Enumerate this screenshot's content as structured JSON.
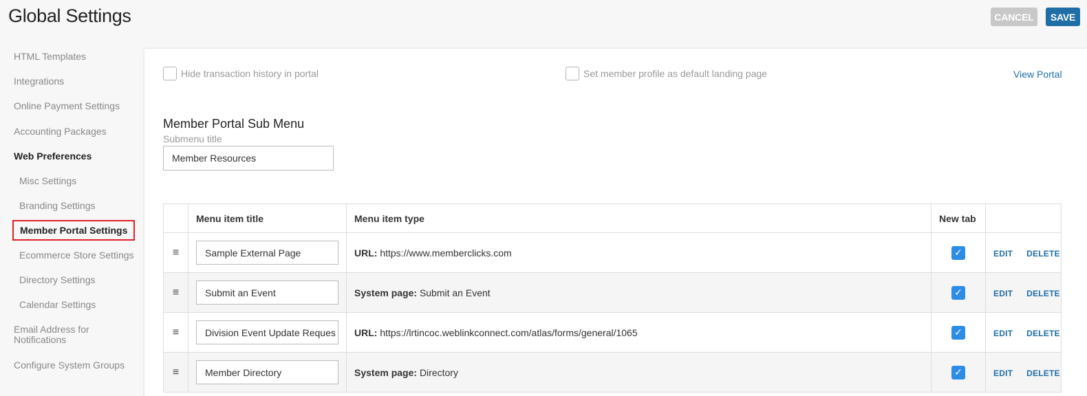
{
  "page_title": "Global Settings",
  "buttons": {
    "cancel": "CANCEL",
    "save": "SAVE"
  },
  "sidebar": {
    "items": [
      {
        "label": "HTML Templates"
      },
      {
        "label": "Integrations"
      },
      {
        "label": "Online Payment Settings"
      },
      {
        "label": "Accounting Packages"
      },
      {
        "label": "Web Preferences"
      },
      {
        "label": "Misc Settings"
      },
      {
        "label": "Branding Settings"
      },
      {
        "label": "Member Portal Settings"
      },
      {
        "label": "Ecommerce Store Settings"
      },
      {
        "label": "Directory Settings"
      },
      {
        "label": "Calendar Settings"
      },
      {
        "label": "Email Address for"
      },
      {
        "label": "Notifications"
      },
      {
        "label": "Configure System Groups"
      }
    ]
  },
  "options": {
    "hide_history": "Hide transaction history in portal",
    "default_landing": "Set member profile as default landing page",
    "view_portal": "View Portal"
  },
  "submenu": {
    "section_title": "Member Portal Sub Menu",
    "field_label": "Submenu title",
    "value": "Member Resources"
  },
  "table": {
    "headers": {
      "title": "Menu item title",
      "type": "Menu item type",
      "new_tab": "New tab"
    },
    "edit_label": "EDIT",
    "delete_label": "DELETE",
    "rows": [
      {
        "title": "Sample External Page",
        "type_label": "URL:",
        "type_value": "https://www.memberclicks.com",
        "new_tab": true
      },
      {
        "title": "Submit an Event",
        "type_label": "System page:",
        "type_value": "Submit an Event",
        "new_tab": true
      },
      {
        "title": "Division Event Update Reques",
        "type_label": "URL:",
        "type_value": "https://lrtincoc.weblinkconnect.com/atlas/forms/general/1065",
        "new_tab": true
      },
      {
        "title": "Member Directory",
        "type_label": "System page:",
        "type_value": "Directory",
        "new_tab": true
      }
    ]
  },
  "colors": {
    "accent": "#1f6fa6",
    "checkbox_checked": "#2d8ce6",
    "highlight_border": "#e01f26"
  },
  "icons": {
    "drag": "drag-handle-icon",
    "check": "checkmark-icon"
  }
}
